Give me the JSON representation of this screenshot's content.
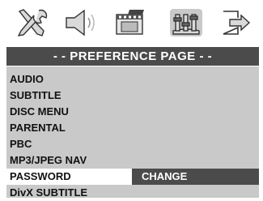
{
  "toolbar": {
    "icons": [
      "tools-icon",
      "speaker-icon",
      "film-icon",
      "preference-icon",
      "exit-icon"
    ]
  },
  "header": {
    "title": "- -  PREFERENCE PAGE  - -"
  },
  "menu": {
    "items": [
      {
        "label": "AUDIO"
      },
      {
        "label": "SUBTITLE"
      },
      {
        "label": "DISC MENU"
      },
      {
        "label": "PARENTAL"
      },
      {
        "label": "PBC"
      },
      {
        "label": "MP3/JPEG NAV"
      },
      {
        "label": "PASSWORD"
      },
      {
        "label": "DivX SUBTITLE"
      }
    ],
    "selected_label": "PASSWORD",
    "submenu_label": "CHANGE"
  },
  "colors": {
    "header_bg": "#4b4b4b",
    "menu_bg": "#c9c9c9",
    "selected_bg": "#ffffff",
    "submenu_bg": "#4b4b4b"
  }
}
